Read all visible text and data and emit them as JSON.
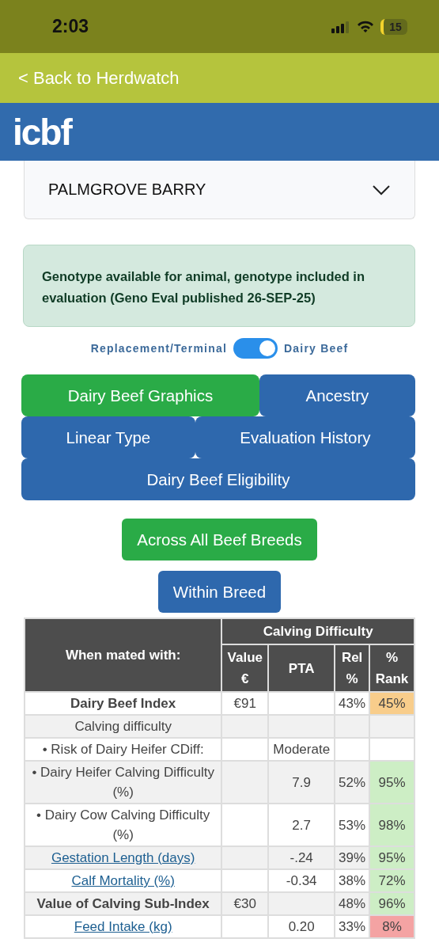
{
  "status_bar": {
    "time": "2:03",
    "battery": "15"
  },
  "back_link": "< Back to Herdwatch",
  "header": {
    "logo": "icbf"
  },
  "animal_select": {
    "value": "PALMGROVE BARRY"
  },
  "alert": "Genotype available for animal, genotype included in evaluation (Geno Eval published 26-SEP-25)",
  "toggle": {
    "left_label": "Replacement/Terminal",
    "right_label": "Dairy Beef",
    "on": true
  },
  "tabs": [
    {
      "label": "Dairy Beef Graphics",
      "selected": true
    },
    {
      "label": "Ancestry",
      "selected": false
    },
    {
      "label": "Linear Type",
      "selected": false
    },
    {
      "label": "Evaluation History",
      "selected": false
    },
    {
      "label": "Dairy Beef Eligibility",
      "selected": false
    }
  ],
  "breed_buttons": [
    {
      "label": "Across All Beef Breeds",
      "selected": true
    },
    {
      "label": "Within Breed",
      "selected": false
    }
  ],
  "table": {
    "corner": "When mated with:",
    "group": "Calving Difficulty",
    "columns": [
      "Value €",
      "PTA",
      "Rel %",
      "% Rank"
    ],
    "rows": [
      {
        "kind": "bold",
        "label": "Dairy Beef Index",
        "value": "€91",
        "pta": "",
        "rel": "43%",
        "rank": "45%",
        "color": "#f8cd8b"
      },
      {
        "kind": "plain",
        "label": "Calving difficulty",
        "value": "",
        "pta": "",
        "rel": "",
        "rank": ""
      },
      {
        "kind": "plain",
        "label": "• Risk of Dairy Heifer CDiff:",
        "value": "",
        "pta": "Moderate",
        "rel": "",
        "rank": ""
      },
      {
        "kind": "plain",
        "label": "• Dairy Heifer Calving Difficulty (%)",
        "value": "",
        "pta": "7.9",
        "rel": "52%",
        "rank": "95%",
        "color": "#cdeec5"
      },
      {
        "kind": "plain",
        "label": "• Dairy Cow Calving Difficulty (%)",
        "value": "",
        "pta": "2.7",
        "rel": "53%",
        "rank": "98%",
        "color": "#cdeec5"
      },
      {
        "kind": "link",
        "label": "Gestation Length (days)",
        "value": "",
        "pta": "-.24",
        "rel": "39%",
        "rank": "95%",
        "color": "#cdeec5"
      },
      {
        "kind": "link",
        "label": "Calf Mortality (%)",
        "value": "",
        "pta": "-0.34",
        "rel": "38%",
        "rank": "72%",
        "color": "#cdeec5"
      },
      {
        "kind": "bold",
        "label": "Value of Calving Sub-Index",
        "value": "€30",
        "pta": "",
        "rel": "48%",
        "rank": "96%",
        "color": "#cdeec5"
      },
      {
        "kind": "link",
        "label": "Feed Intake (kg)",
        "value": "",
        "pta": "0.20",
        "rel": "33%",
        "rank": "8%",
        "color": "#f4a3a3"
      }
    ]
  }
}
